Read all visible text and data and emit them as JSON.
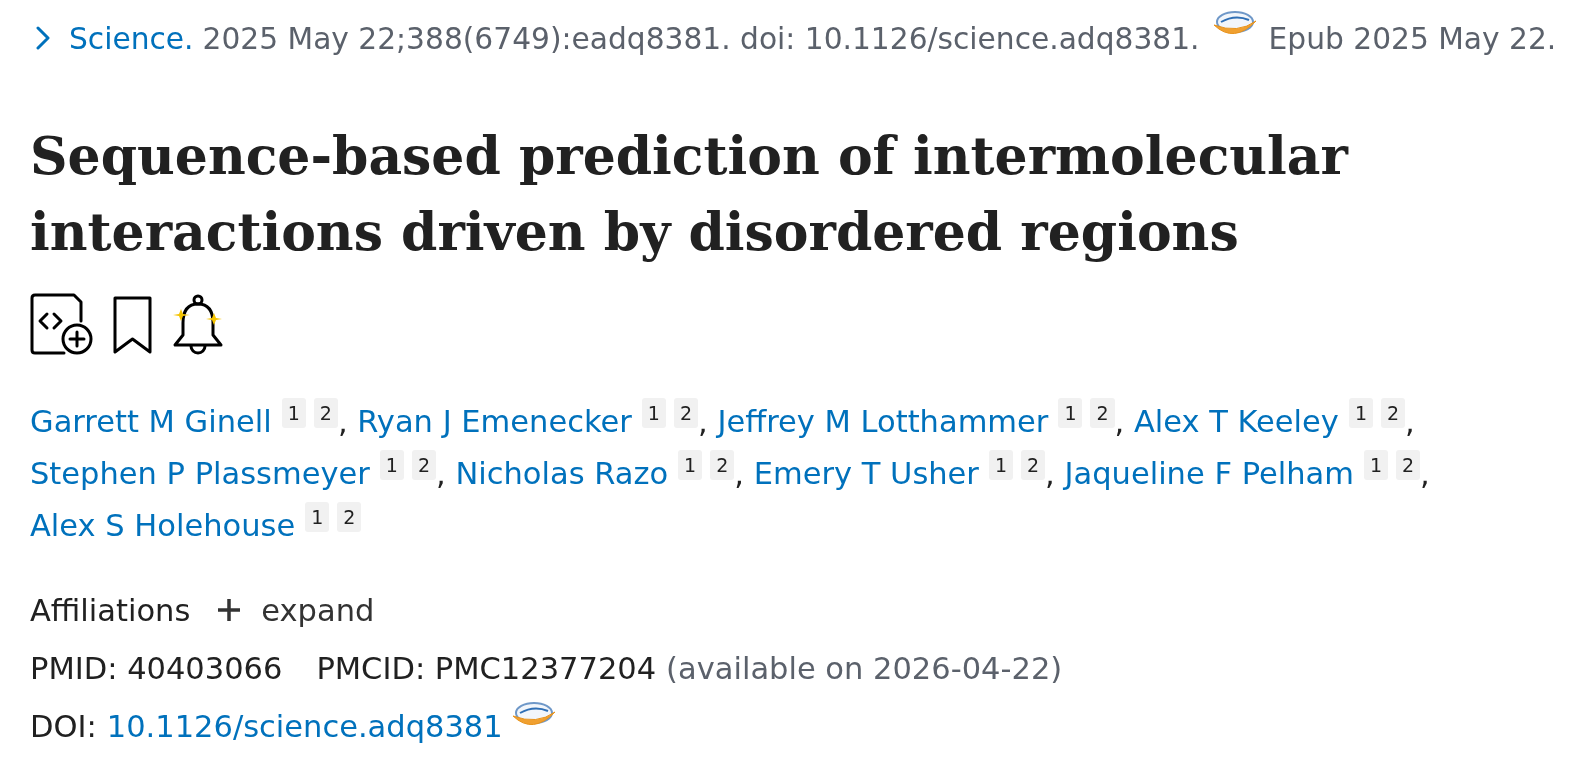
{
  "citation": {
    "journal": "Science.",
    "details": "2025 May 22;388(6749):eadq8381. doi: 10.1126/science.adq8381.",
    "epub": "Epub 2025 May 22."
  },
  "title": "Sequence-based prediction of intermolecular interactions driven by disordered regions",
  "authors": {
    "separator": ",",
    "list": [
      {
        "name": "Garrett M Ginell",
        "affiliations": [
          "1",
          "2"
        ]
      },
      {
        "name": "Ryan J Emenecker",
        "affiliations": [
          "1",
          "2"
        ]
      },
      {
        "name": "Jeffrey M Lotthammer",
        "affiliations": [
          "1",
          "2"
        ]
      },
      {
        "name": "Alex T Keeley",
        "affiliations": [
          "1",
          "2"
        ]
      },
      {
        "name": "Stephen P Plassmeyer",
        "affiliations": [
          "1",
          "2"
        ]
      },
      {
        "name": "Nicholas Razo",
        "affiliations": [
          "1",
          "2"
        ]
      },
      {
        "name": "Emery T Usher",
        "affiliations": [
          "1",
          "2"
        ]
      },
      {
        "name": "Jaqueline F Pelham",
        "affiliations": [
          "1",
          "2"
        ]
      },
      {
        "name": "Alex S Holehouse",
        "affiliations": [
          "1",
          "2"
        ]
      }
    ]
  },
  "affiliations": {
    "label": "Affiliations",
    "toggle": "expand"
  },
  "identifiers": {
    "pmid": "PMID: 40403066",
    "pmcid": "PMCID: PMC12377204",
    "pmcid_note": "(available on 2026-04-22)",
    "doi_label": "DOI:",
    "doi": "10.1126/science.adq8381"
  }
}
